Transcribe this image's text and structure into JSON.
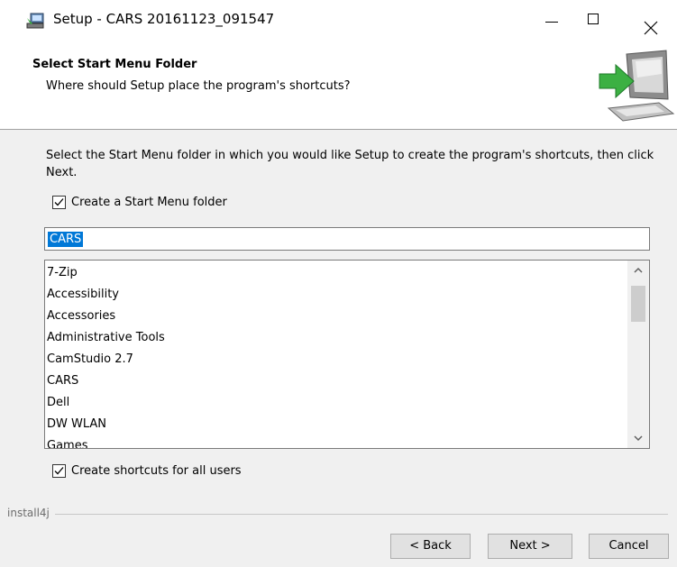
{
  "window": {
    "title": "Setup - CARS 20161123_091547"
  },
  "header": {
    "title": "Select Start Menu Folder",
    "subtitle": "Where should Setup place the program's shortcuts?"
  },
  "body": {
    "description": "Select the Start Menu folder in which you would like Setup to create the program's shortcuts, then click Next.",
    "create_folder_label": "Create a Start Menu folder",
    "create_folder_checked": true,
    "folder_name_value": "CARS",
    "folder_list": [
      "7-Zip",
      "Accessibility",
      "Accessories",
      "Administrative Tools",
      "CamStudio 2.7",
      "CARS",
      "Dell",
      "DW WLAN",
      "Games"
    ],
    "all_users_label": "Create shortcuts for all users",
    "all_users_checked": true
  },
  "footer": {
    "brand": "install4j",
    "back_label": "< Back",
    "next_label": "Next >",
    "cancel_label": "Cancel"
  },
  "colors": {
    "selection": "#0078d7",
    "arrow_green": "#3cb043"
  }
}
